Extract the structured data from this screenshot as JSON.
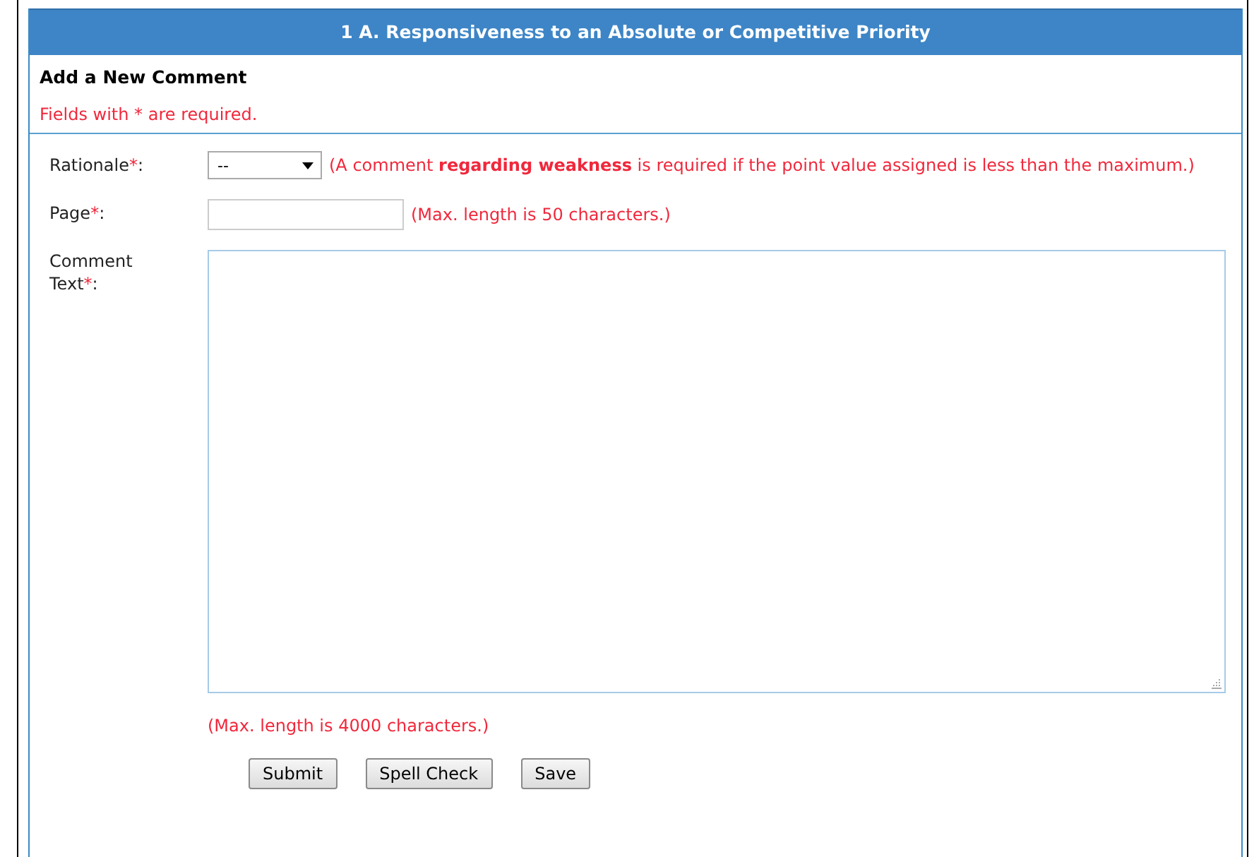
{
  "header": {
    "title": "1 A. Responsiveness to an Absolute or Competitive Priority"
  },
  "section": {
    "title": "Add a New Comment",
    "required_note": "Fields with * are required."
  },
  "fields": [
    {
      "kind": "select",
      "label": "Rationale",
      "required_mark": "*",
      "colon": ":",
      "value": "--",
      "hint": "(A comment **regarding weakness** is required if the point value assigned is less than the maximum.)"
    },
    {
      "kind": "text",
      "label": "Page",
      "required_mark": "*",
      "colon": ":",
      "hint": "(Max. length is 50 characters.)"
    },
    {
      "kind": "textarea",
      "label": "Comment Text",
      "required_mark": "*",
      "colon": ":",
      "hint": "(Max. length is 4000 characters.)"
    }
  ],
  "buttons": [
    "Submit",
    "Spell Check",
    "Save"
  ]
}
